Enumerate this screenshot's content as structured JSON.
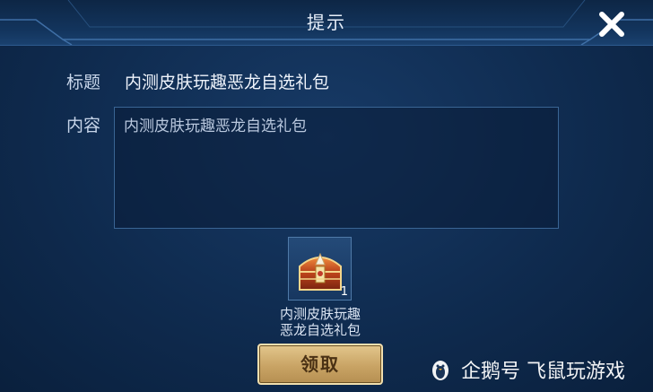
{
  "dialog": {
    "title": "提示",
    "close_icon": "close-icon"
  },
  "fields": {
    "title_label": "标题",
    "title_value": "内测皮肤玩趣恶龙自选礼包",
    "content_label": "内容",
    "content_value": "内测皮肤玩趣恶龙自选礼包"
  },
  "item": {
    "icon": "treasure-chest-icon",
    "count": "1",
    "name": "内测皮肤玩趣恶龙自选礼包"
  },
  "claim_button": {
    "label": "领取"
  },
  "watermark": {
    "icon": "penguin-icon",
    "text": "企鹅号 飞鼠玩游戏"
  },
  "colors": {
    "background": "#0f2b4f",
    "header": "#13355e",
    "button_gold": "#c9a465",
    "button_text": "#4a3114"
  }
}
